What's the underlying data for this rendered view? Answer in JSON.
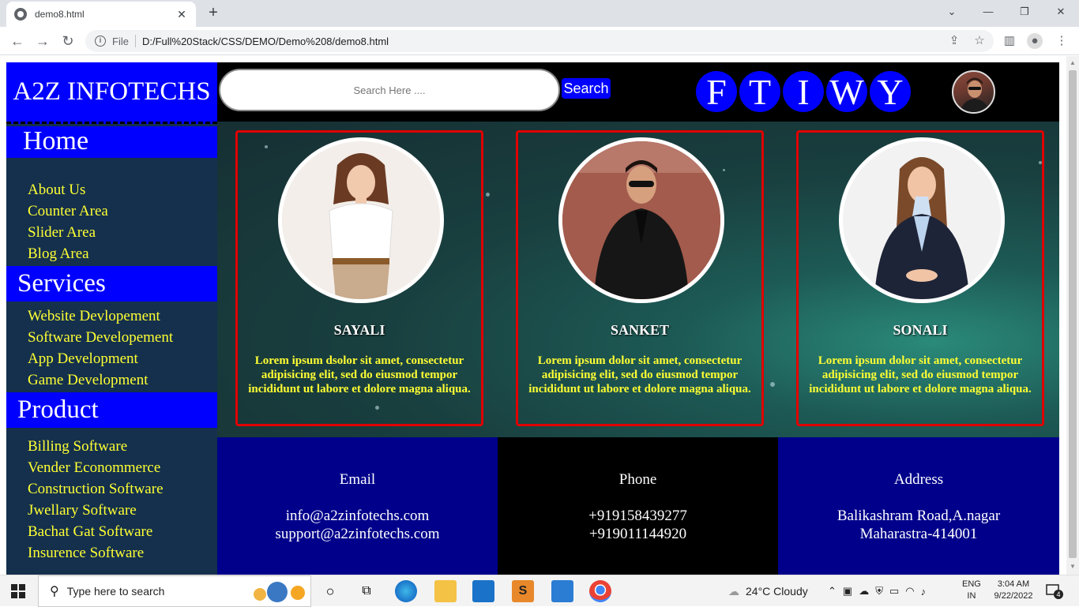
{
  "browser": {
    "tab_title": "demo8.html",
    "url_scheme": "File",
    "url": "D:/Full%20Stack/CSS/DEMO/Demo%208/demo8.html"
  },
  "site": {
    "logo": "A2Z INFOTECHS",
    "search_placeholder": "Search Here ....",
    "search_button": "Search",
    "social": [
      "F",
      "T",
      "I",
      "W",
      "Y"
    ]
  },
  "sidebar": {
    "sections": [
      {
        "title": "Home",
        "items": [
          "About Us",
          "Counter Area",
          "Slider Area",
          "Blog Area"
        ]
      },
      {
        "title": "Services",
        "items": [
          "Website Devlopement",
          "Software Developement",
          "App Development",
          "Game Development"
        ]
      },
      {
        "title": "Product",
        "items": [
          "Billing Software",
          "Vender Econommerce",
          "Construction Software",
          "Jwellary Software",
          "Bachat Gat Software",
          "Insurence Software"
        ]
      }
    ]
  },
  "cards": [
    {
      "name": "SAYALI",
      "text": "Lorem ipsum dsolor sit amet, consectetur adipisicing elit, sed do eiusmod tempor incididunt ut labore et dolore magna aliqua."
    },
    {
      "name": "SANKET",
      "text": "Lorem ipsum dolor sit amet, consectetur adipisicing elit, sed do eiusmod tempor incididunt ut labore et dolore magna aliqua."
    },
    {
      "name": "SONALI",
      "text": "Lorem ipsum dolor sit amet, consectetur adipisicing elit, sed do eiusmod tempor incididunt ut labore et dolore magna aliqua."
    }
  ],
  "footer": {
    "email": {
      "title": "Email",
      "lines": [
        "info@a2zinfotechs.com",
        "support@a2zinfotechs.com"
      ]
    },
    "phone": {
      "title": "Phone",
      "lines": [
        "+919158439277",
        "+919011144920"
      ]
    },
    "address": {
      "title": "Address",
      "lines": [
        "Balikashram Road,A.nagar",
        "Maharastra-414001"
      ]
    }
  },
  "taskbar": {
    "search_placeholder": "Type here to search",
    "weather": "24°C  Cloudy",
    "lang_1": "ENG",
    "lang_2": "IN",
    "time": "3:04 AM",
    "date": "9/22/2022",
    "notifications": "4"
  },
  "colors": {
    "brand_blue": "#0000ff",
    "link_yellow": "#ffff33",
    "card_border": "#e00000",
    "sidebar_bg": "#14304d",
    "footer_navy": "#00008b"
  }
}
